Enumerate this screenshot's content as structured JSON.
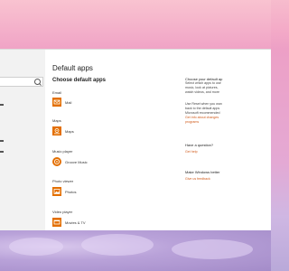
{
  "page": {
    "title": "Default apps",
    "subtitle": "Choose default apps"
  },
  "categories": [
    {
      "label": "Email",
      "app": "Mail",
      "icon": "mail-icon"
    },
    {
      "label": "Maps",
      "app": "Maps",
      "icon": "maps-icon"
    },
    {
      "label": "Music player",
      "app": "Groove Music",
      "icon": "groove-music-icon"
    },
    {
      "label": "Photo viewer",
      "app": "Photos",
      "icon": "photos-icon"
    },
    {
      "label": "Video player",
      "app": "Movies & TV",
      "icon": "movies-tv-icon"
    }
  ],
  "right_panel": {
    "heading": "Choose your default ap",
    "body_lines": [
      "Select which apps to use",
      "music, look at pictures,",
      "watch videos, and more"
    ],
    "body2_lines": [
      "Use Reset when you wan",
      "back to the default apps",
      "Microsoft recommended"
    ],
    "link1_lines": [
      "Get info about changes",
      "programs"
    ],
    "question": "Have a question?",
    "get_help": "Get help",
    "better_heading": "Make Windows better",
    "feedback_link": "Give us feedback"
  },
  "colors": {
    "accent": "#e36f00",
    "link": "#d05a1a"
  }
}
